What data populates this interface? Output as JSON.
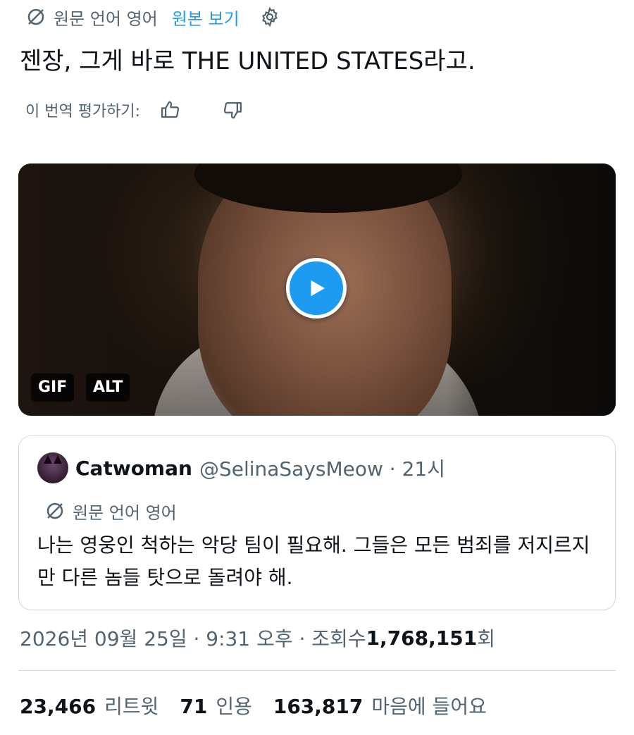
{
  "translation_bar": {
    "source_language": "원문 언어 영어",
    "view_original": "원본 보기"
  },
  "tweet": {
    "text": "젠장, 그게 바로 THE UNITED STATES라고."
  },
  "rating": {
    "label": "이 번역 평가하기:"
  },
  "media": {
    "gif_badge": "GIF",
    "alt_badge": "ALT"
  },
  "quote": {
    "name": "Catwoman",
    "handle_time": "@SelinaSaysMeow · 21시",
    "source_language": "원문 언어 영어",
    "text": "나는 영웅인 척하는 악당 팀이 필요해. 그들은 모든 범죄를 저지르지만 다른 놈들 탓으로 돌려야 해."
  },
  "meta": {
    "date_time": "2026년 09월 25일 · 9:31 오후 · 조회수 ",
    "views": "1,768,151",
    "views_unit": "회"
  },
  "stats": {
    "retweets": "23,466",
    "retweets_label": "리트윗",
    "quotes": "71",
    "quotes_label": "인용",
    "likes": "163,817",
    "likes_label": "마음에 들어요"
  },
  "colors": {
    "accent": "#1d9bf0",
    "secondary_text": "#536471",
    "primary_text": "#0f1419",
    "border": "#cfd9de"
  }
}
